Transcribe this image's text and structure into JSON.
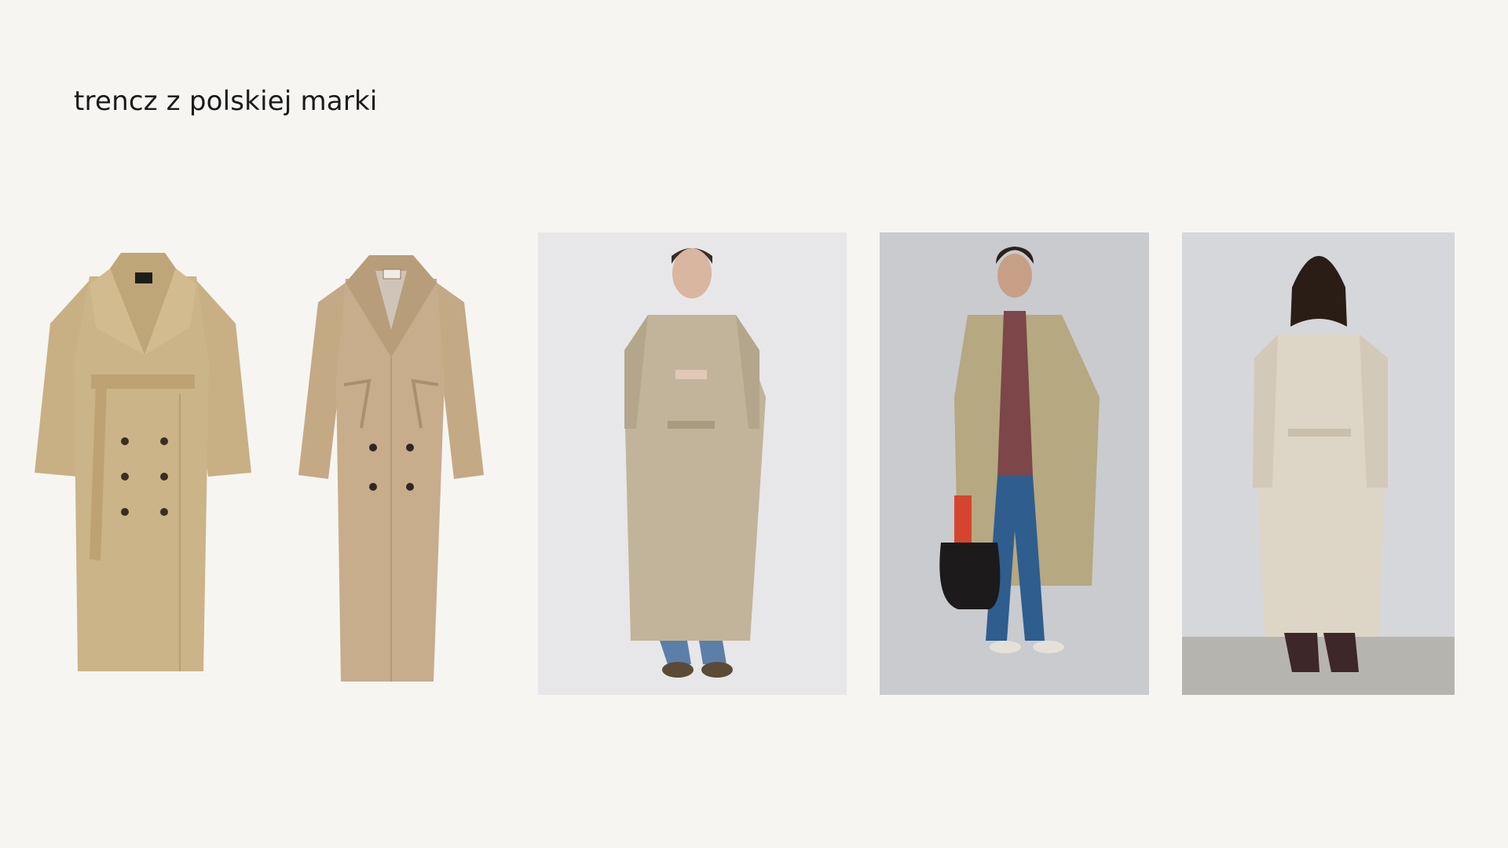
{
  "slide": {
    "title": "trencz z polskiej marki",
    "background_color": "#f6f5f1"
  },
  "images": [
    {
      "name": "trench-coat-product-1",
      "kind": "product cutout",
      "coat_color": "#cbb487"
    },
    {
      "name": "trench-coat-product-2",
      "kind": "product cutout",
      "coat_color": "#c7ad8c"
    },
    {
      "name": "model-photo-1",
      "kind": "model photo",
      "coat_color": "#c1b49a",
      "backdrop": "#e7e7e9"
    },
    {
      "name": "model-photo-2",
      "kind": "model photo",
      "coat_color": "#b6a880",
      "backdrop": "#c9cbcf"
    },
    {
      "name": "model-photo-3",
      "kind": "model photo",
      "coat_color": "#ddd5c6",
      "backdrop": "#d6d7db"
    }
  ]
}
